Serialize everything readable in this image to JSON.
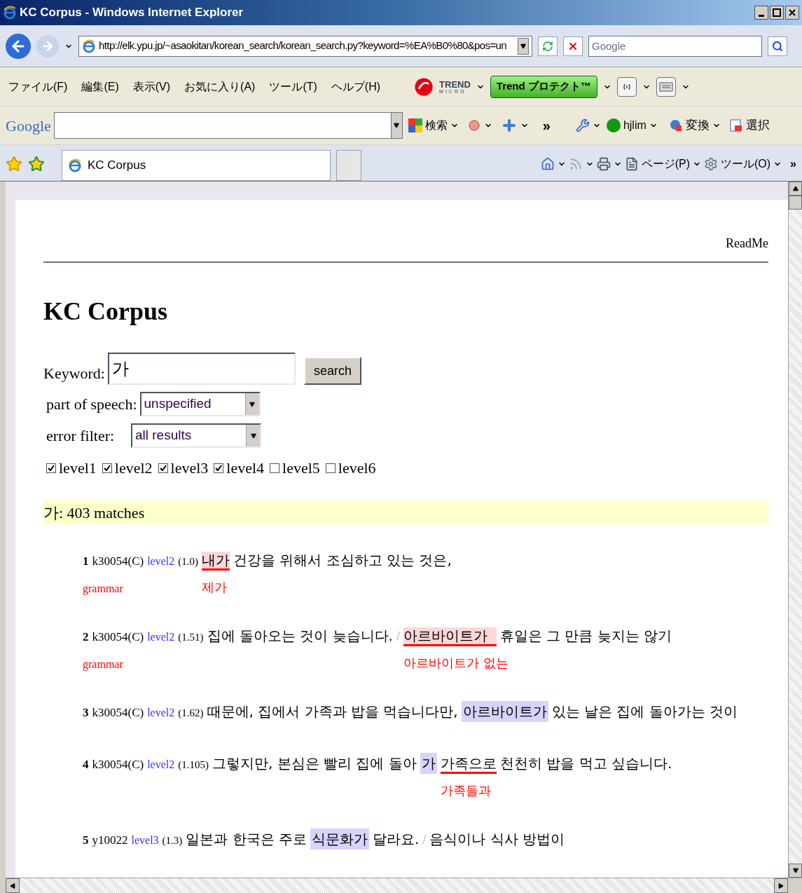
{
  "window": {
    "title": "KC Corpus - Windows Internet Explorer"
  },
  "address_bar": {
    "url": "http://elk.ypu.jp/~asaokitan/korean_search/korean_search.py?keyword=%EA%B0%80&pos=un",
    "search_placeholder": "Google"
  },
  "menu": [
    "ファイル(F)",
    "編集(E)",
    "表示(V)",
    "お気に入り(A)",
    "ツール(T)",
    "ヘルプ(H)"
  ],
  "trend_toolbar": {
    "logo_top": "TREND",
    "logo_bottom": "MICRO",
    "button": "Trend プロテクト™"
  },
  "google_toolbar": {
    "logo": "Google",
    "search": "検索",
    "more": "»",
    "user": "hjlim",
    "convert": "変換",
    "select": "選択"
  },
  "tabs": [
    {
      "label": "KC Corpus",
      "selected": true
    }
  ],
  "command_bar": {
    "page": "ページ(P)",
    "tools": "ツール(O)",
    "more": "»"
  },
  "page": {
    "readme": "ReadMe",
    "title": "KC Corpus",
    "form": {
      "keyword_label": "Keyword:",
      "keyword": "가",
      "search_button": "search",
      "pos_label": "part of speech:",
      "pos_value": "unspecified",
      "error_label": "error filter:",
      "error_value": "all results",
      "levels": [
        {
          "label": "level1",
          "checked": true
        },
        {
          "label": "level2",
          "checked": true
        },
        {
          "label": "level3",
          "checked": true
        },
        {
          "label": "level4",
          "checked": true
        },
        {
          "label": "level5",
          "checked": false
        },
        {
          "label": "level6",
          "checked": false
        }
      ]
    },
    "summary": "가: 403 matches",
    "results": [
      {
        "num": "1",
        "doc": "k30054(C)",
        "level": "level2",
        "score": "(1.0)",
        "tag": "grammar",
        "segments": [
          {
            "kind": "error",
            "text": "내가",
            "fix": "제가"
          },
          {
            "kind": "plain",
            "text": "건강을 위해서 조심하고 있는 것은,"
          }
        ]
      },
      {
        "num": "2",
        "doc": "k30054(C)",
        "level": "level2",
        "score": "(1.51)",
        "tag": "grammar",
        "segments": [
          {
            "kind": "plain",
            "text": "집에 돌아오는 것이 늦습니다."
          },
          {
            "kind": "sep",
            "text": "/"
          },
          {
            "kind": "error",
            "text": "아르바이트가  ",
            "fix": "아르바이트가 없는"
          },
          {
            "kind": "plain",
            "text": "휴일은 그 만큼 늦지는 않기"
          }
        ]
      },
      {
        "num": "3",
        "doc": "k30054(C)",
        "level": "level2",
        "score": "(1.62)",
        "segments": [
          {
            "kind": "plain",
            "text": "때문에, 집에서 가족과 밥을 먹습니다만,"
          },
          {
            "kind": "hit",
            "text": "아르바이트가"
          },
          {
            "kind": "plain",
            "text": "있는 날은 집에 돌아가는 것이"
          }
        ]
      },
      {
        "num": "4",
        "doc": "k30054(C)",
        "level": "level2",
        "score": "(1.105)",
        "segments": [
          {
            "kind": "plain",
            "text": "그렇지만, 본심은 빨리 집에 돌아"
          },
          {
            "kind": "hit",
            "text": "가"
          },
          {
            "kind": "fix",
            "text": "가족으로",
            "fix": "가족들과"
          },
          {
            "kind": "plain",
            "text": "천천히 밥을 먹고 싶습니다."
          }
        ]
      },
      {
        "num": "5",
        "doc": "y10022",
        "level": "level3",
        "score": "(1.3)",
        "segments": [
          {
            "kind": "plain",
            "text": "일본과 한국은 주로"
          },
          {
            "kind": "hit",
            "text": "식문화가"
          },
          {
            "kind": "plain",
            "text": "달라요."
          },
          {
            "kind": "sep",
            "text": "/"
          },
          {
            "kind": "plain",
            "text": "음식이나 식사 방법이"
          }
        ]
      }
    ]
  }
}
